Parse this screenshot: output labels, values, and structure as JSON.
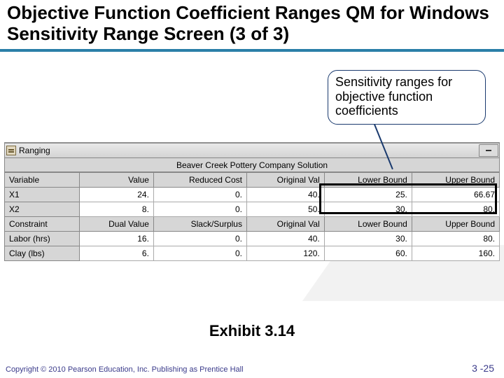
{
  "title": "Objective Function Coefficient Ranges QM for Windows Sensitivity Range Screen (3 of 3)",
  "callout": "Sensitivity ranges for objective function coefficients",
  "window": {
    "title": "Ranging",
    "subtitle": "Beaver Creek Pottery Company Solution",
    "headers1": [
      "Variable",
      "Value",
      "Reduced Cost",
      "Original Val",
      "Lower Bound",
      "Upper Bound"
    ],
    "rows1": [
      {
        "label": "X1",
        "cells": [
          "24.",
          "0.",
          "40.",
          "25.",
          "66.67"
        ]
      },
      {
        "label": "X2",
        "cells": [
          "8.",
          "0.",
          "50.",
          "30.",
          "80."
        ]
      }
    ],
    "headers2": [
      "Constraint",
      "Dual Value",
      "Slack/Surplus",
      "Original Val",
      "Lower Bound",
      "Upper Bound"
    ],
    "rows2": [
      {
        "label": "Labor (hrs)",
        "cells": [
          "16.",
          "0.",
          "40.",
          "30.",
          "80."
        ]
      },
      {
        "label": "Clay (lbs)",
        "cells": [
          "6.",
          "0.",
          "120.",
          "60.",
          "160."
        ]
      }
    ]
  },
  "exhibit": "Exhibit 3.14",
  "copyright": "Copyright © 2010 Pearson Education, Inc. Publishing as Prentice Hall",
  "pagenum": "3 -25",
  "chart_data": {
    "type": "table",
    "title": "Ranging — Beaver Creek Pottery Company Solution",
    "variable_ranging": {
      "columns": [
        "Variable",
        "Value",
        "Reduced Cost",
        "Original Val",
        "Lower Bound",
        "Upper Bound"
      ],
      "rows": [
        [
          "X1",
          24,
          0,
          40,
          25,
          66.67
        ],
        [
          "X2",
          8,
          0,
          50,
          30,
          80
        ]
      ]
    },
    "constraint_ranging": {
      "columns": [
        "Constraint",
        "Dual Value",
        "Slack/Surplus",
        "Original Val",
        "Lower Bound",
        "Upper Bound"
      ],
      "rows": [
        [
          "Labor (hrs)",
          16,
          0,
          40,
          30,
          80
        ],
        [
          "Clay (lbs)",
          6,
          0,
          120,
          60,
          160
        ]
      ]
    }
  }
}
